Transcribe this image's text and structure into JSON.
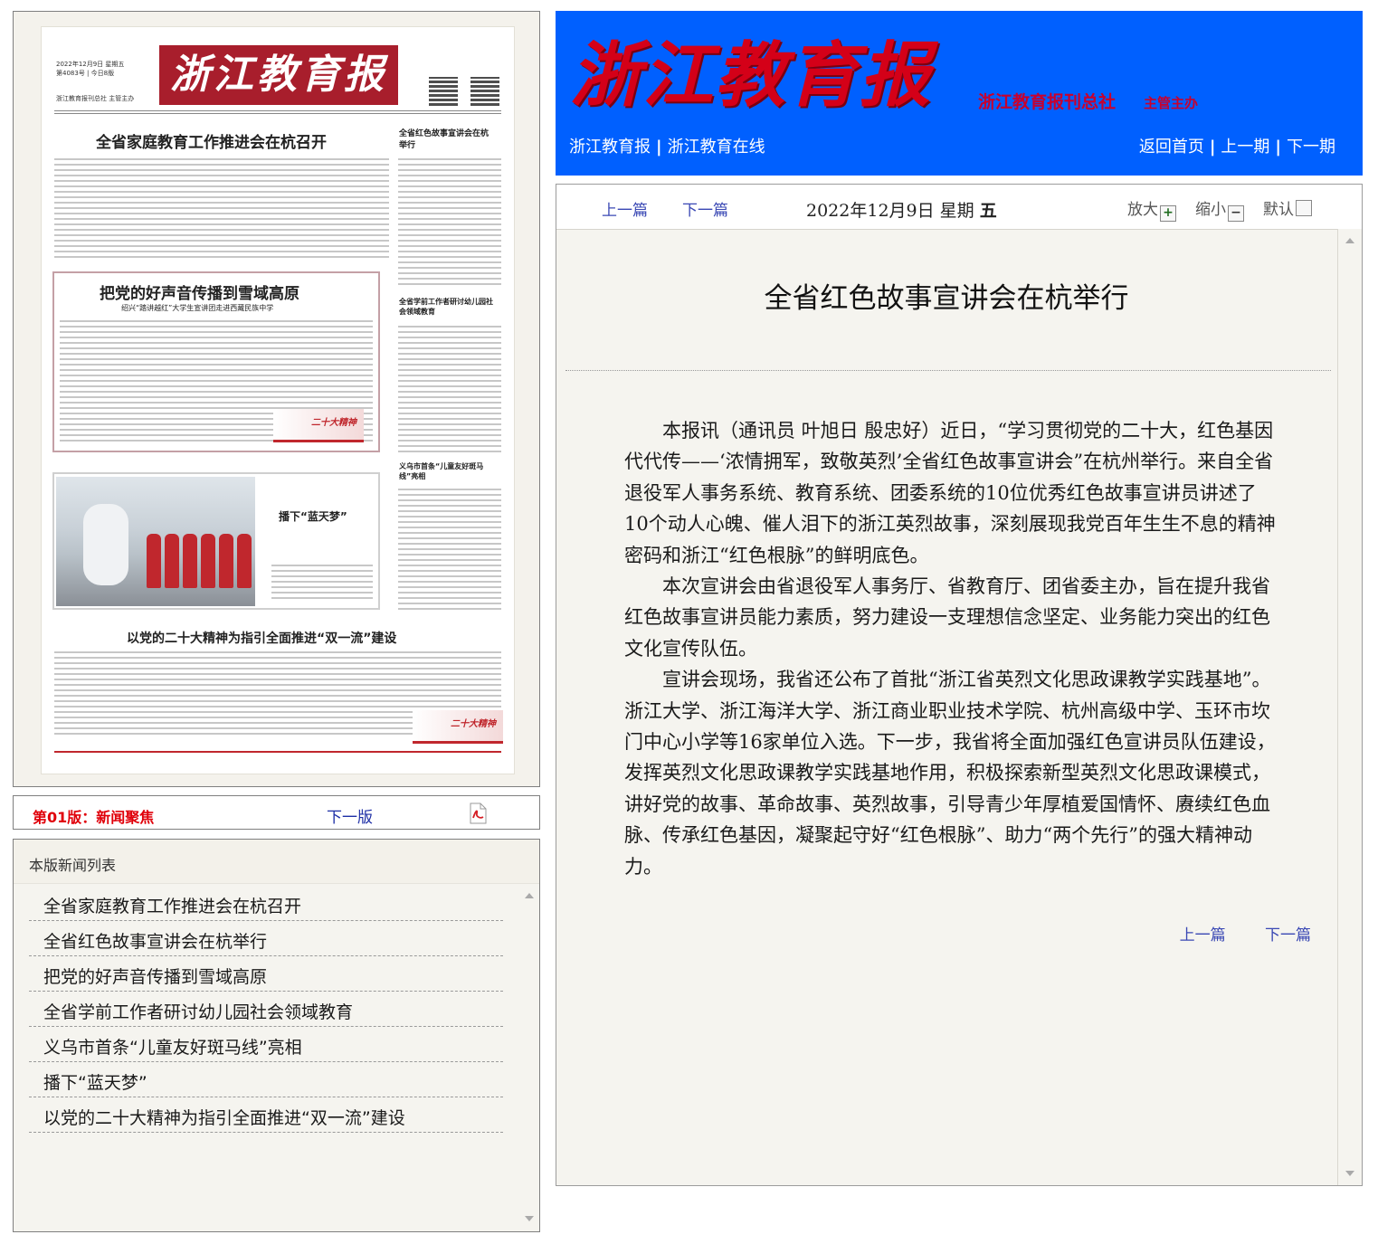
{
  "newspaper": {
    "masthead": "浙江教育报",
    "date_line": "2022年12月9日 星期五",
    "issue_line": "第4083号 | 今日8版",
    "publisher_line": "浙江教育报刊总社 主管主办",
    "headlines": {
      "main": "全省家庭教育工作推进会在杭召开",
      "side1": "全省红色故事宣讲会在杭举行",
      "box": "把党的好声音传播到雪域高原",
      "box_sub": "绍兴“踏讲越红”大学生宣讲团走进西藏民族中学",
      "side2": "全省学前工作者研讨幼儿园社会领域教育",
      "side3": "义乌市首条“儿童友好斑马线”亮相",
      "photo": "播下“蓝天梦”",
      "bottom": "以党的二十大精神为指引全面推进“双一流”建设"
    },
    "stamp": "二十大精神"
  },
  "version_bar": {
    "title": "第01版：新闻聚焦",
    "next": "下一版",
    "pdf_icon": "pdf-icon"
  },
  "news_list": {
    "heading": "本版新闻列表",
    "items": [
      "全省家庭教育工作推进会在杭召开",
      "全省红色故事宣讲会在杭举行",
      "把党的好声音传播到雪域高原",
      "全省学前工作者研讨幼儿园社会领域教育",
      "义乌市首条“儿童友好斑马线”亮相",
      "播下“蓝天梦”",
      "以党的二十大精神为指引全面推进“双一流”建设"
    ]
  },
  "banner": {
    "logo": "浙江教育报",
    "org": "浙江教育报刊总社",
    "org_sub": "主管主办",
    "nav_left": [
      "浙江教育报",
      "浙江教育在线"
    ],
    "nav_right": [
      "返回首页",
      "上一期",
      "下一期"
    ],
    "bg_color": "#0060ff"
  },
  "toolbar": {
    "prev": "上一篇",
    "next": "下一篇",
    "date": "2022年12月9日  星期",
    "weekday": "五",
    "zoom_in": "放大",
    "zoom_out": "缩小",
    "zoom_default": "默认"
  },
  "article": {
    "title": "全省红色故事宣讲会在杭举行",
    "paragraphs": [
      "本报讯（通讯员 叶旭日 殷忠好）近日，“学习贯彻党的二十大，红色基因代代传——‘浓情拥军，致敬英烈’全省红色故事宣讲会”在杭州举行。来自全省退役军人事务系统、教育系统、团委系统的10位优秀红色故事宣讲员讲述了10个动人心魄、催人泪下的浙江英烈故事，深刻展现我党百年生生不息的精神密码和浙江“红色根脉”的鲜明底色。",
      "本次宣讲会由省退役军人事务厅、省教育厅、团省委主办，旨在提升我省红色故事宣讲员能力素质，努力建设一支理想信念坚定、业务能力突出的红色文化宣传队伍。",
      "宣讲会现场，我省还公布了首批“浙江省英烈文化思政课教学实践基地”。浙江大学、浙江海洋大学、浙江商业职业技术学院、杭州高级中学、玉环市坎门中心小学等16家单位入选。下一步，我省将全面加强红色宣讲员队伍建设，发挥英烈文化思政课教学实践基地作用，积极探索新型英烈文化思政课模式，讲好党的故事、革命故事、英烈故事，引导青少年厚植爱国情怀、赓续红色血脉、传承红色基因，凝聚起守好“红色根脉”、助力“两个先行”的强大精神动力。"
    ],
    "footer_prev": "上一篇",
    "footer_next": "下一篇"
  }
}
